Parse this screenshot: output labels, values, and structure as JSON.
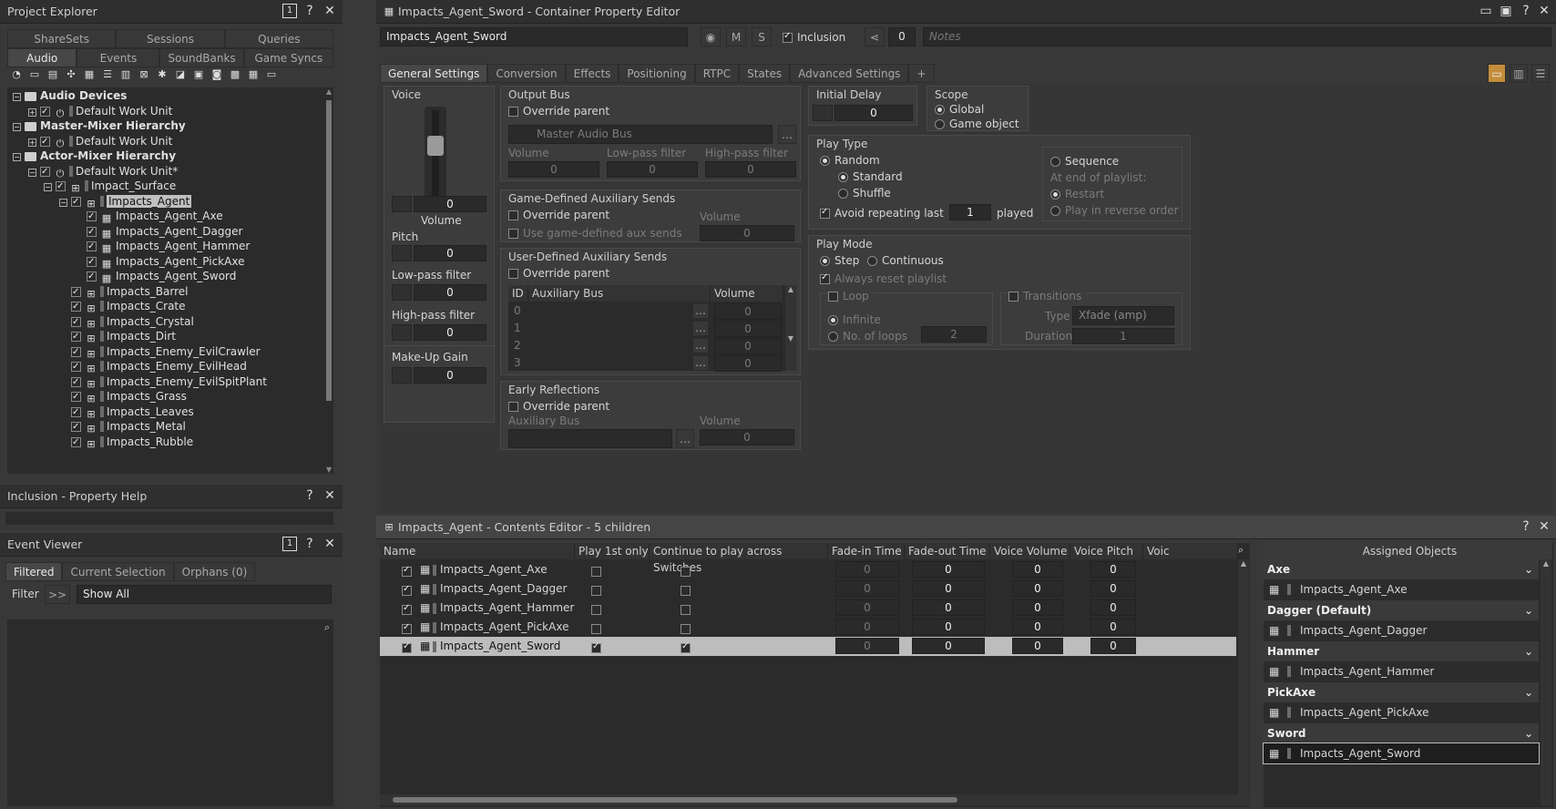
{
  "project_explorer": {
    "title": "Project Explorer",
    "tabs_row1": [
      "ShareSets",
      "Sessions",
      "Queries"
    ],
    "tabs_row2": [
      "Audio",
      "Events",
      "SoundBanks",
      "Game Syncs"
    ],
    "active_tab": "Audio",
    "tree": [
      {
        "label": "Audio Devices",
        "bold": true,
        "level": 0,
        "type": "folder"
      },
      {
        "label": "Default Work Unit",
        "level": 1,
        "type": "wu"
      },
      {
        "label": "Master-Mixer Hierarchy",
        "bold": true,
        "level": 0,
        "type": "folder"
      },
      {
        "label": "Default Work Unit",
        "level": 1,
        "type": "wu"
      },
      {
        "label": "Actor-Mixer Hierarchy",
        "bold": true,
        "level": 0,
        "type": "folder"
      },
      {
        "label": "Default Work Unit*",
        "level": 1,
        "type": "wu"
      },
      {
        "label": "Impact_Surface",
        "level": 2,
        "type": "switch"
      },
      {
        "label": "Impacts_Agent",
        "level": 3,
        "type": "switch",
        "selected": true
      },
      {
        "label": "Impacts_Agent_Axe",
        "level": 4,
        "type": "random"
      },
      {
        "label": "Impacts_Agent_Dagger",
        "level": 4,
        "type": "random"
      },
      {
        "label": "Impacts_Agent_Hammer",
        "level": 4,
        "type": "random"
      },
      {
        "label": "Impacts_Agent_PickAxe",
        "level": 4,
        "type": "random"
      },
      {
        "label": "Impacts_Agent_Sword",
        "level": 4,
        "type": "random"
      },
      {
        "label": "Impacts_Barrel",
        "level": 3,
        "type": "switch"
      },
      {
        "label": "Impacts_Crate",
        "level": 3,
        "type": "switch"
      },
      {
        "label": "Impacts_Crystal",
        "level": 3,
        "type": "switch"
      },
      {
        "label": "Impacts_Dirt",
        "level": 3,
        "type": "switch"
      },
      {
        "label": "Impacts_Enemy_EvilCrawler",
        "level": 3,
        "type": "switch"
      },
      {
        "label": "Impacts_Enemy_EvilHead",
        "level": 3,
        "type": "switch"
      },
      {
        "label": "Impacts_Enemy_EvilSpitPlant",
        "level": 3,
        "type": "switch"
      },
      {
        "label": "Impacts_Grass",
        "level": 3,
        "type": "switch"
      },
      {
        "label": "Impacts_Leaves",
        "level": 3,
        "type": "switch"
      },
      {
        "label": "Impacts_Metal",
        "level": 3,
        "type": "switch"
      },
      {
        "label": "Impacts_Rubble",
        "level": 3,
        "type": "switch"
      }
    ]
  },
  "inclusion_help": {
    "title": "Inclusion - Property Help"
  },
  "event_viewer": {
    "title": "Event Viewer",
    "tabs": [
      "Filtered",
      "Current Selection",
      "Orphans (0)"
    ],
    "filter_label": "Filter",
    "filter_btn": ">>",
    "filter_value": "Show All"
  },
  "editor": {
    "title": "Impacts_Agent_Sword - Container Property Editor",
    "name": "Impacts_Agent_Sword",
    "m": "M",
    "s": "S",
    "inclusion": "Inclusion",
    "color_count": "0",
    "notes_placeholder": "Notes",
    "tabs": [
      "General Settings",
      "Conversion",
      "Effects",
      "Positioning",
      "RTPC",
      "States",
      "Advanced Settings",
      "+"
    ],
    "voice": {
      "title": "Voice",
      "volume": "0",
      "volume_label": "Volume",
      "pitch_label": "Pitch",
      "pitch": "0",
      "lpf_label": "Low-pass filter",
      "lpf": "0",
      "hpf_label": "High-pass filter",
      "hpf": "0",
      "makeup_label": "Make-Up Gain",
      "makeup": "0"
    },
    "output_bus": {
      "title": "Output Bus",
      "override": "Override parent",
      "bus": "Master Audio Bus",
      "volume": "Volume",
      "lpf": "Low-pass filter",
      "hpf": "High-pass filter",
      "v1": "0",
      "v2": "0",
      "v3": "0"
    },
    "game_aux": {
      "title": "Game-Defined Auxiliary Sends",
      "override": "Override parent",
      "use": "Use game-defined aux sends",
      "volume": "Volume",
      "value": "0"
    },
    "user_aux": {
      "title": "User-Defined Auxiliary Sends",
      "override": "Override parent",
      "col_id": "ID",
      "col_bus": "Auxiliary Bus",
      "col_vol": "Volume",
      "rows": [
        "0",
        "1",
        "2",
        "3"
      ],
      "vals": [
        "0",
        "0",
        "0",
        "0"
      ]
    },
    "early": {
      "title": "Early Reflections",
      "override": "Override parent",
      "bus": "Auxiliary Bus",
      "volume": "Volume",
      "value": "0"
    },
    "initial_delay": {
      "title": "Initial Delay",
      "value": "0"
    },
    "scope": {
      "title": "Scope",
      "global": "Global",
      "game_object": "Game object"
    },
    "play_type": {
      "title": "Play Type",
      "random": "Random",
      "standard": "Standard",
      "shuffle": "Shuffle",
      "avoid": "Avoid repeating last",
      "avoid_n": "1",
      "played": "played",
      "sequence": "Sequence",
      "end_of_playlist": "At end of playlist:",
      "restart": "Restart",
      "reverse": "Play in reverse order"
    },
    "play_mode": {
      "title": "Play Mode",
      "step": "Step",
      "continuous": "Continuous",
      "always_reset": "Always reset playlist",
      "loop": "Loop",
      "infinite": "Infinite",
      "loops": "No. of loops",
      "loops_n": "2",
      "transitions": "Transitions",
      "type_label": "Type",
      "type_value": "Xfade (amp)",
      "duration_label": "Duration",
      "duration": "1"
    }
  },
  "contents": {
    "title": "Impacts_Agent - Contents Editor - 5 children",
    "columns": [
      "Name",
      "Play 1st only",
      "Continue to play across Switches",
      "Fade-in Time",
      "Fade-out Time",
      "Voice Volume",
      "Voice Pitch",
      "Voic"
    ],
    "rows": [
      {
        "name": "Impacts_Agent_Axe",
        "fadein": "0",
        "fadeout": "0",
        "vol": "0",
        "pitch": "0"
      },
      {
        "name": "Impacts_Agent_Dagger",
        "fadein": "0",
        "fadeout": "0",
        "vol": "0",
        "pitch": "0"
      },
      {
        "name": "Impacts_Agent_Hammer",
        "fadein": "0",
        "fadeout": "0",
        "vol": "0",
        "pitch": "0"
      },
      {
        "name": "Impacts_Agent_PickAxe",
        "fadein": "0",
        "fadeout": "0",
        "vol": "0",
        "pitch": "0"
      },
      {
        "name": "Impacts_Agent_Sword",
        "fadein": "0",
        "fadeout": "0",
        "vol": "0",
        "pitch": "0",
        "selected": true
      }
    ],
    "assigned_title": "Assigned Objects",
    "assigned": [
      {
        "group": "Axe",
        "item": "Impacts_Agent_Axe"
      },
      {
        "group": "Dagger (Default)",
        "item": "Impacts_Agent_Dagger"
      },
      {
        "group": "Hammer",
        "item": "Impacts_Agent_Hammer"
      },
      {
        "group": "PickAxe",
        "item": "Impacts_Agent_PickAxe"
      },
      {
        "group": "Sword",
        "item": "Impacts_Agent_Sword"
      }
    ]
  }
}
